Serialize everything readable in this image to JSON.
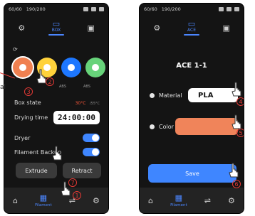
{
  "status": {
    "storage": "60/60",
    "wifi": "190/200"
  },
  "left": {
    "tabs": [
      {
        "label": "",
        "icon": "gear-icon"
      },
      {
        "label": "BOX",
        "icon": "box-icon"
      },
      {
        "label": "",
        "icon": "printer-icon"
      }
    ],
    "spools": [
      {
        "color": "#f08050",
        "label": ""
      },
      {
        "color": "#ffd23b",
        "label": ""
      },
      {
        "color": "#1d77ff",
        "label": "ABS"
      },
      {
        "color": "#67d37a",
        "label": "ABS"
      }
    ],
    "box_state_label": "Box state",
    "box_state_value": "30°C",
    "box_state_secondary": "/55°C",
    "drying_time_label": "Drying time",
    "drying_time_value": "24:00:00",
    "dryer_label": "Dryer",
    "filament_backup_label": "Filament Backup",
    "extrude_label": "Extrude",
    "retract_label": "Retract",
    "bottom": [
      "",
      "Filament",
      "",
      ""
    ]
  },
  "right": {
    "tabs": [
      {
        "label": "",
        "icon": "gear-icon"
      },
      {
        "label": "ACE",
        "icon": "box-icon"
      },
      {
        "label": "",
        "icon": "printer-icon"
      }
    ],
    "title": "ACE 1-1",
    "material_label": "Material",
    "material_value": "PLA",
    "color_label": "Color",
    "color_value": "#f0845a",
    "save_label": "Save",
    "bottom": [
      "",
      "Filament",
      "",
      ""
    ]
  },
  "annotations": {
    "n1": "1",
    "n2": "2",
    "n3": "3",
    "n4": "4",
    "n5": "5",
    "n6": "6",
    "n7": "7",
    "edge_label": "al"
  }
}
